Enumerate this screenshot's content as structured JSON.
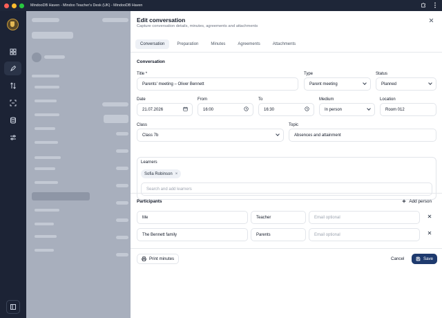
{
  "window": {
    "title": "MindooDB Haven - Mindoo Teacher's Desk (UK) - MindooDB Haven"
  },
  "modal": {
    "title": "Edit conversation",
    "subtitle": "Capture conversation details, minutes, agreements and attachments",
    "tabs": [
      "Conversation",
      "Preparation",
      "Minutes",
      "Agreements",
      "Attachments"
    ],
    "active_tab": "Conversation"
  },
  "conversation": {
    "section": "Conversation",
    "title_label": "Title *",
    "title_value": "Parents' meeting – Oliver Bennett",
    "type_label": "Type",
    "type_value": "Parent meeting",
    "status_label": "Status",
    "status_value": "Planned",
    "date_label": "Date",
    "date_value": "21.07.2026",
    "from_label": "From",
    "from_value": "16:00",
    "to_label": "To",
    "to_value": "16:30",
    "medium_label": "Medium",
    "medium_value": "In person",
    "location_label": "Location",
    "location_value": "Room 012",
    "class_label": "Class",
    "class_value": "Class 7b",
    "topic_label": "Topic",
    "topic_value": "Absences and attainment"
  },
  "learners": {
    "label": "Learners",
    "chips": [
      "Sofia Robinson"
    ],
    "search_placeholder": "Search and add learners"
  },
  "participants": {
    "section": "Participants",
    "add_label": "Add person",
    "email_placeholder": "Email optional",
    "rows": [
      {
        "name": "Me",
        "role": "Teacher"
      },
      {
        "name": "The Bennett family",
        "role": "Parents"
      }
    ]
  },
  "footer": {
    "print_label": "Print minutes",
    "cancel_label": "Cancel",
    "save_label": "Save"
  },
  "colors": {
    "primary": "#1e3a6e",
    "rail": "#1c2335"
  }
}
